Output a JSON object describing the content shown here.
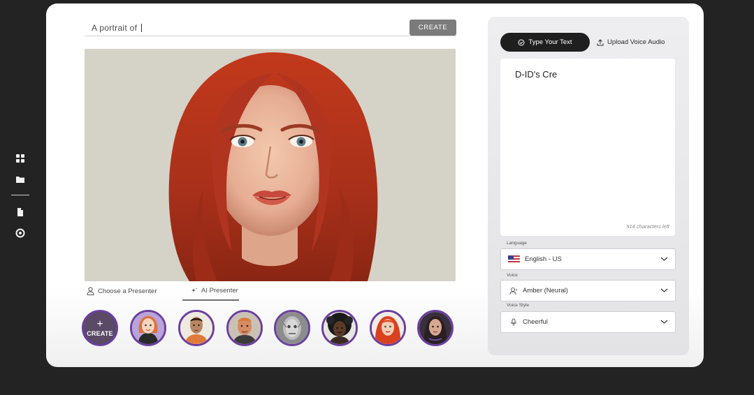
{
  "prompt": {
    "text": "A portrait of",
    "create_label": "CREATE"
  },
  "presenter_tabs": [
    {
      "label": "Choose a Presenter",
      "icon": "person-icon"
    },
    {
      "label": "AI Presenter",
      "icon": "sparkle-icon"
    }
  ],
  "avatars": {
    "create_plus": "+",
    "create_label": "CREATE",
    "items": [
      "orange-hair-cartoon",
      "man-orange-shirt",
      "blond-man",
      "robot-face",
      "curly-hair-woman",
      "red-hair-woman",
      "dark-hair-woman"
    ]
  },
  "right_panel": {
    "tab_text": "Type Your Text",
    "tab_upload": "Upload Voice Audio",
    "text_value": "D-ID's Cre",
    "chars_left": "514 characters left",
    "language": {
      "label": "Language",
      "value": "English - US"
    },
    "voice": {
      "label": "Voice",
      "value": "Amber (Neural)"
    },
    "voice_style": {
      "label": "Voice Style",
      "value": "Cheerful"
    }
  },
  "colors": {
    "accent": "#6b3fa0",
    "dark_button": "#1f1f1f",
    "create_button": "#7b7b7b"
  }
}
